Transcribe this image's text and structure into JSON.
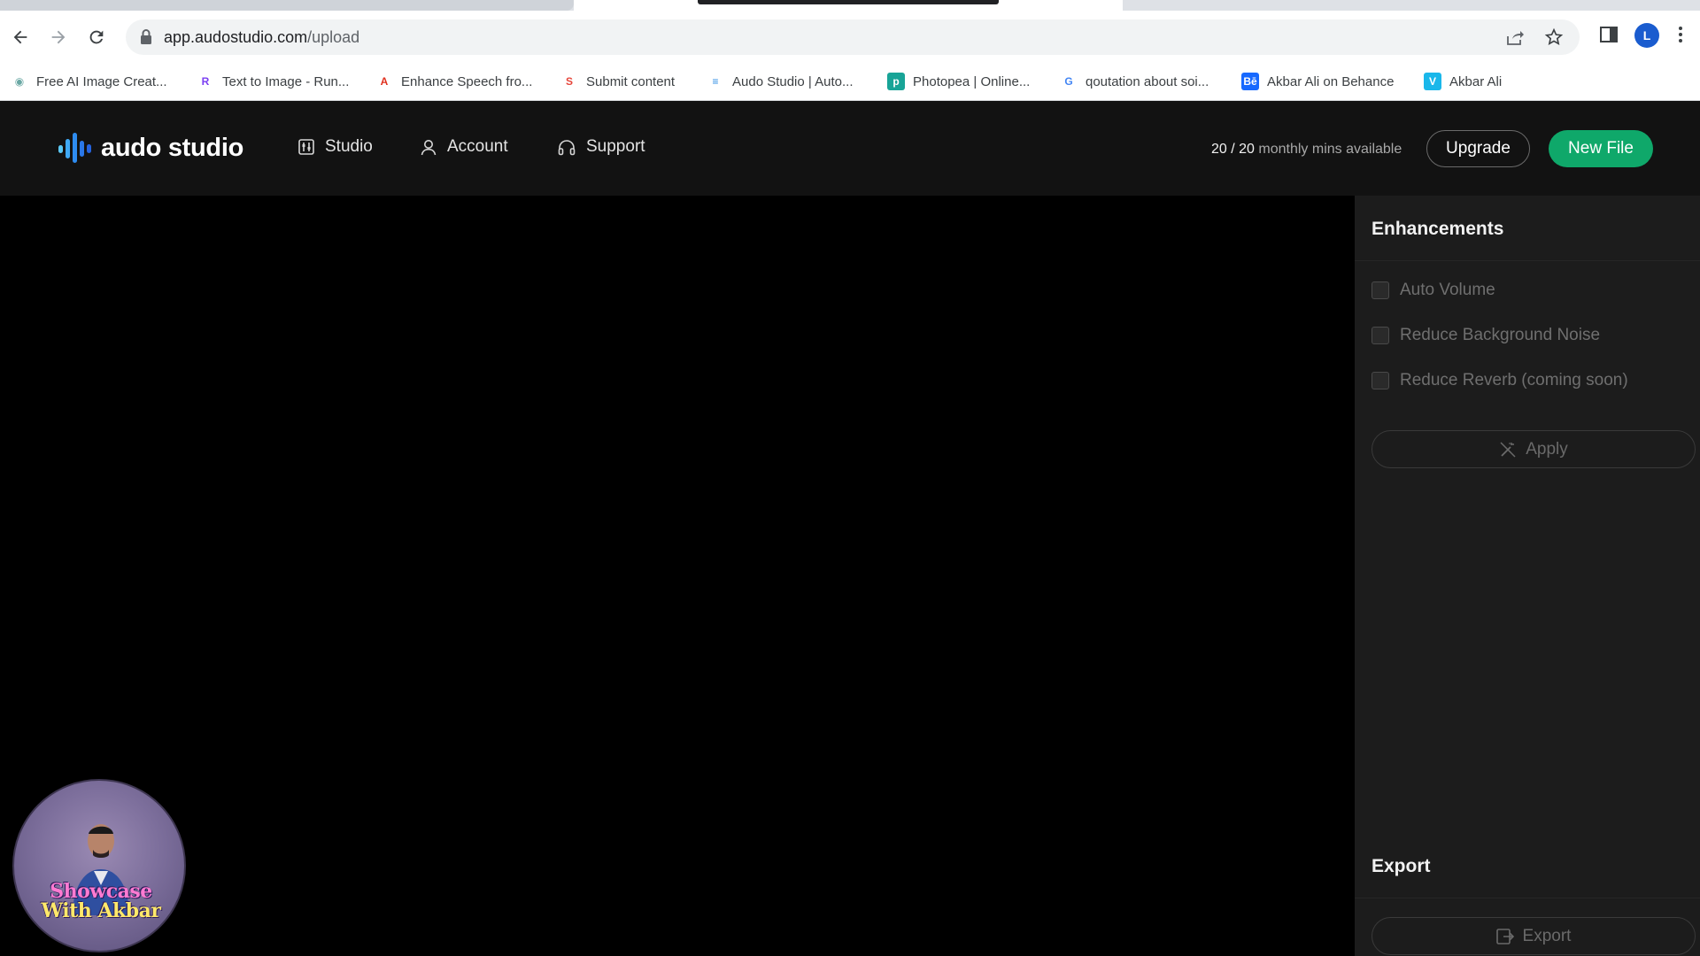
{
  "browser": {
    "url_host": "app.audostudio.com",
    "url_path": "/upload",
    "profile_initial": "L",
    "bookmarks": [
      {
        "label": "Free AI Image Creat...",
        "icon": "ai-image-icon",
        "color": "#6aa8a4"
      },
      {
        "label": "Text to Image - Run...",
        "icon": "runway-icon",
        "color": "#7b3ff2"
      },
      {
        "label": "Enhance Speech fro...",
        "icon": "adobe-icon",
        "color": "#e0301e"
      },
      {
        "label": "Submit content",
        "icon": "submit-icon",
        "color": "#e6463b"
      },
      {
        "label": "Audo Studio | Auto...",
        "icon": "audo-icon",
        "color": "#2f8de4"
      },
      {
        "label": "Photopea | Online...",
        "icon": "photopea-icon",
        "color": "#18a497"
      },
      {
        "label": "qoutation about soi...",
        "icon": "google-icon",
        "color": "#4285f4"
      },
      {
        "label": "Akbar Ali on Behance",
        "icon": "behance-icon",
        "color": "#1769ff"
      },
      {
        "label": "Akbar Ali",
        "icon": "vimeo-icon",
        "color": "#1ab7ea"
      }
    ]
  },
  "header": {
    "logo_text": "audo studio",
    "nav": [
      {
        "label": "Studio",
        "icon": "studio-icon"
      },
      {
        "label": "Account",
        "icon": "user-icon"
      },
      {
        "label": "Support",
        "icon": "headphones-icon"
      }
    ],
    "quota_used": "20 / 20",
    "quota_text": "monthly mins available",
    "upgrade_label": "Upgrade",
    "new_file_label": "New File",
    "accent": "#0fa86a"
  },
  "panel": {
    "enhancements_title": "Enhancements",
    "options": [
      {
        "label": "Auto Volume",
        "checked": false
      },
      {
        "label": "Reduce Background Noise",
        "checked": false
      },
      {
        "label": "Reduce Reverb (coming soon)",
        "checked": false
      }
    ],
    "apply_label": "Apply",
    "export_title": "Export",
    "export_label": "Export"
  },
  "overlay": {
    "line1": "Showcase",
    "line2": "With Akbar"
  }
}
